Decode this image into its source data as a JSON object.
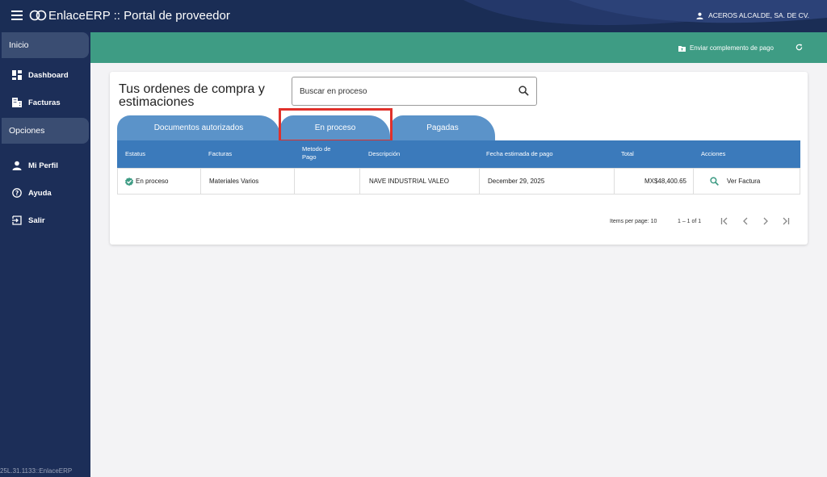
{
  "header": {
    "app_title": "EnlaceERP :: Portal de proveedor",
    "user_name": "ACEROS ALCALDE, SA. DE CV."
  },
  "sidebar": {
    "section_inicio": "Inicio",
    "section_opciones": "Opciones",
    "items": [
      {
        "label": "Dashboard",
        "icon": "dashboard-icon"
      },
      {
        "label": "Facturas",
        "icon": "building-icon"
      },
      {
        "label": "Mi Perfil",
        "icon": "person-icon"
      },
      {
        "label": "Ayuda",
        "icon": "help-icon"
      },
      {
        "label": "Salir",
        "icon": "logout-icon"
      }
    ],
    "version": "25L.31.1133::EnlaceERP"
  },
  "toolbar": {
    "send_label": "Enviar complemento de pago",
    "refresh_icon": "refresh-icon"
  },
  "main": {
    "title": "Tus ordenes de compra y estimaciones",
    "search_placeholder": "Buscar en proceso",
    "tabs": [
      "Documentos autorizados",
      "En proceso",
      "Pagadas"
    ],
    "active_tab": "En proceso",
    "table": {
      "headers": [
        "Estatus",
        "Facturas",
        "Metodo de Pago",
        "Descripción",
        "Fecha estimada de pago",
        "Total",
        "Acciones"
      ],
      "rows": [
        {
          "status": "En proceso",
          "facturas": "Materiales Varios",
          "metodo": "",
          "descripcion": "NAVE INDUSTRIAL VALEO",
          "fecha": "December 29, 2025",
          "total": "MX$48,400.65",
          "accion": "Ver Factura"
        }
      ]
    },
    "pager": {
      "items_per_page": "Items per page: 10",
      "range": "1 – 1 of 1"
    }
  },
  "colors": {
    "topbar": "#1a2d55",
    "sidebar": "#1c2e58",
    "greenbar": "#3e9c84",
    "tab": "#5b93c9",
    "table_header": "#3b7abb",
    "highlight": "#e0312b",
    "check": "#3e9c84"
  }
}
